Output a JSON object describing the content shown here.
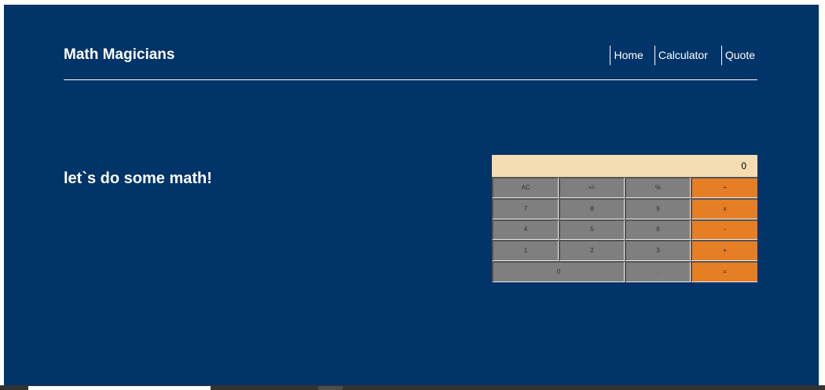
{
  "header": {
    "title": "Math Magicians",
    "nav": [
      {
        "label": "Home"
      },
      {
        "label": "Calculator"
      },
      {
        "label": "Quote"
      }
    ]
  },
  "main": {
    "heading": "let`s do some math!"
  },
  "calculator": {
    "display": "0",
    "keys": [
      "AC",
      "+/-",
      "%",
      "÷",
      "7",
      "8",
      "9",
      "x",
      "4",
      "5",
      "6",
      "-",
      "1",
      "2",
      "3",
      "+",
      "0",
      ".",
      "="
    ]
  },
  "colors": {
    "background": "#013468",
    "display": "#f4dcb3",
    "key": "#7f7f7f",
    "operator": "#e57e25"
  }
}
